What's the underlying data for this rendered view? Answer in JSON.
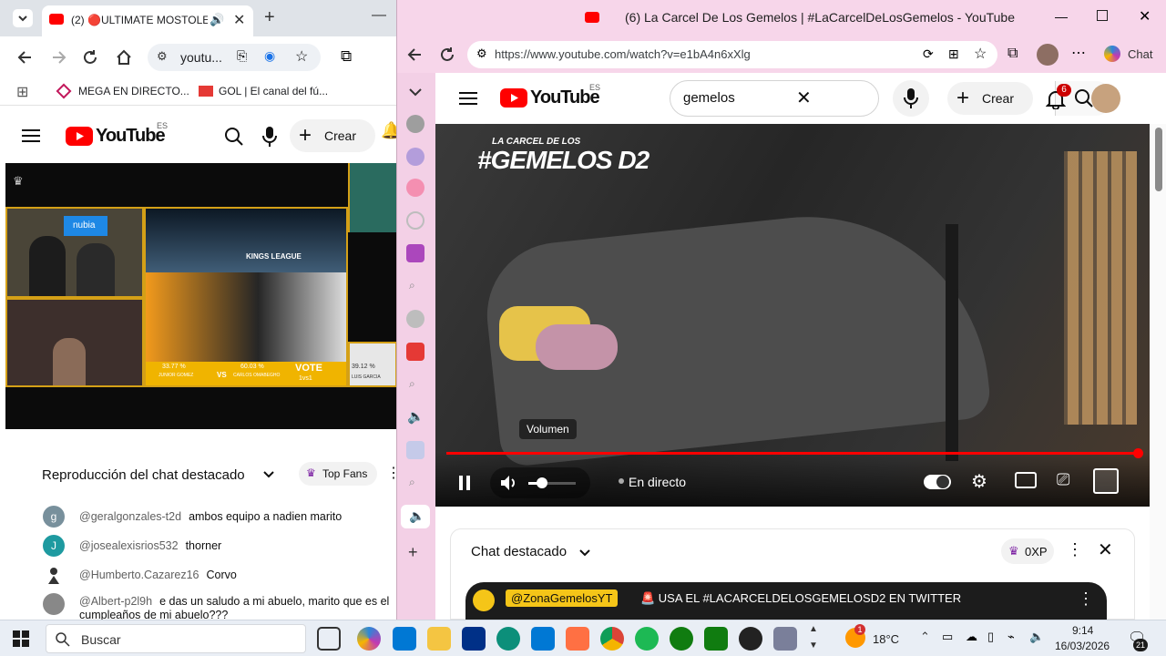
{
  "left_window": {
    "tab": {
      "title": "(2) 🔴ULTIMATE MOSTOLES"
    },
    "address": "youtu...",
    "bookmarks": [
      {
        "label": "MEGA EN DIRECTO..."
      },
      {
        "label": "GOL | El canal del fú..."
      }
    ],
    "yt": {
      "logo_text": "YouTube",
      "region": "ES",
      "create_label": "Crear"
    },
    "video_overlay": {
      "brand": "nubia",
      "players": [
        {
          "name": "JUNIOR GOMEZ",
          "pct": "33.77 %"
        },
        {
          "name": "CARLOS OMABEGHO",
          "pct": "60.03 %"
        },
        {
          "name": "LUIS GARCIA",
          "pct": "39.12 %"
        }
      ],
      "vote": "VOTE",
      "vote_sub": "1vs1",
      "vs": "VS",
      "league": "KINGS LEAGUE"
    },
    "chat": {
      "header": "Reproducción del chat destacado",
      "top_fans": "Top Fans",
      "messages": [
        {
          "initial": "g",
          "author": "@geralgonzales-t2d",
          "text": "ambos equipo a nadien marito",
          "color": "#78909c"
        },
        {
          "initial": "J",
          "author": "@josealexisrios532",
          "text": "thorner",
          "color": "#1e9aa0"
        },
        {
          "initial": "",
          "author": "@Humberto.Cazarez16",
          "text": "Corvo",
          "color": "#ffffff"
        },
        {
          "initial": "",
          "author": "@Albert-p2l9h",
          "text": "e das un saludo a mi abuelo, marito que es el",
          "text2": "cumpleaños de mi abuelo???",
          "color": "#888888"
        }
      ]
    }
  },
  "right_window": {
    "title": "(6) La Carcel De Los Gemelos | #LaCarcelDeLosGemelos - YouTube",
    "url": "https://www.youtube.com/watch?v=e1bA4n6xXlg",
    "chat_label": "Chat",
    "yt": {
      "logo_text": "YouTube",
      "region": "ES",
      "search_value": "gemelos",
      "create_label": "Crear",
      "notif_count": "6"
    },
    "player": {
      "overlay_title_small": "LA CARCEL DE LOS",
      "overlay_title_big": "#GEMELOS D2",
      "tooltip": "Volumen",
      "live_label": "En directo",
      "progress": 1.0,
      "volume": 0.28
    },
    "chat": {
      "header": "Chat destacado",
      "xp": "0XP",
      "pinned_author": "@ZonaGemelosYT",
      "pinned_text": "🚨 USA EL #LACARCELDELOSGEMELOSD2 EN TWITTER"
    }
  },
  "taskbar": {
    "search_placeholder": "Buscar",
    "weather": "18°C",
    "weather_badge": "1",
    "time": "9:14",
    "date": "16/03/2026",
    "notif_count": "21"
  }
}
